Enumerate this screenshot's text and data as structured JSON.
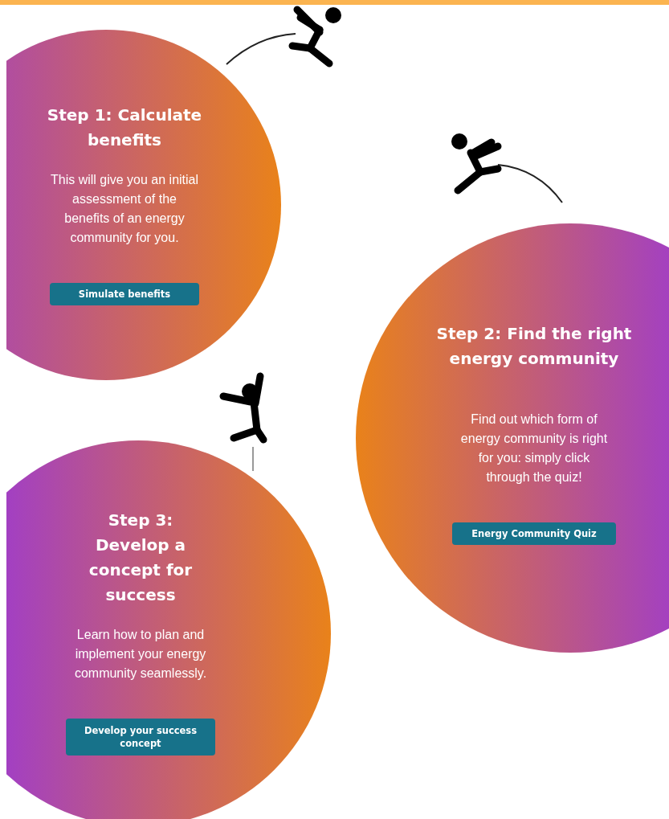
{
  "steps": [
    {
      "title": "Step 1: Calculate benefits",
      "description": "This will give you an initial assessment of the benefits of an energy community for you.",
      "button": "Simulate benefits"
    },
    {
      "title": "Step 2: Find the right energy community",
      "description": "Find out which form of energy community is right for you: simply click through the quiz!",
      "button": "Energy Community Quiz"
    },
    {
      "title": "Step 3: Develop a concept for success",
      "description": "Learn how to plan and implement your energy community seamlessly.",
      "button": "Develop your success concept"
    }
  ]
}
